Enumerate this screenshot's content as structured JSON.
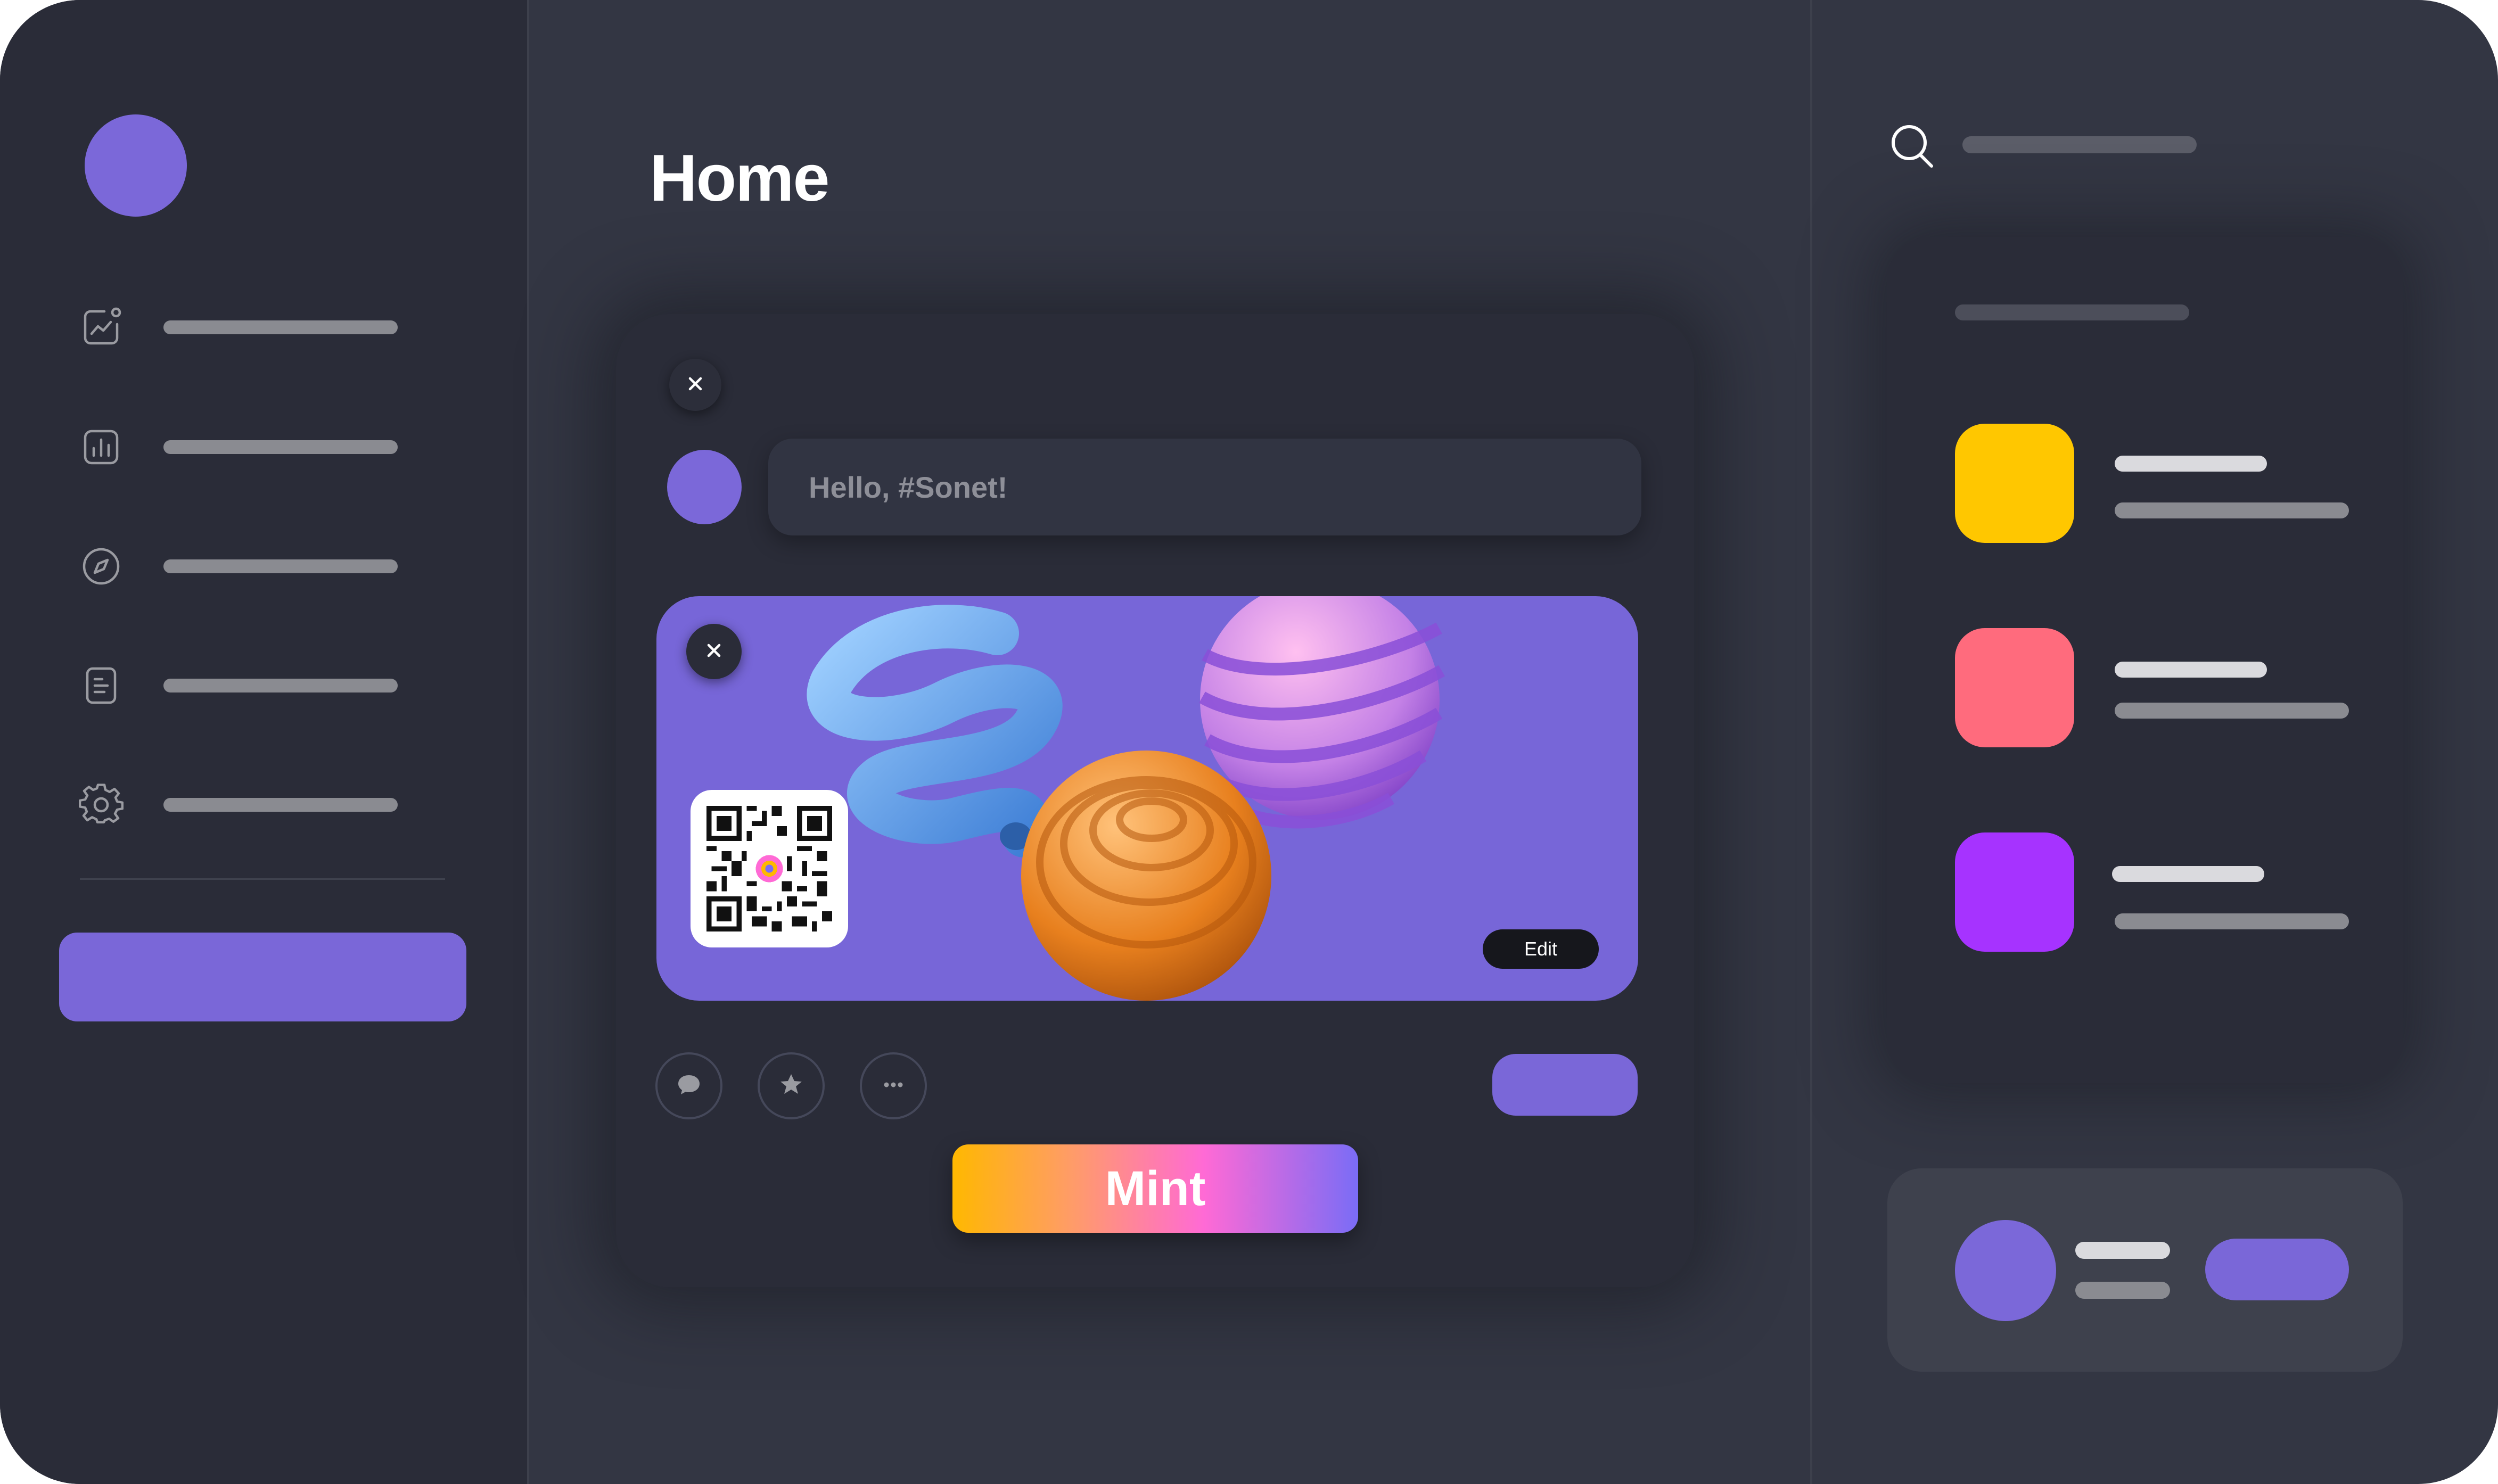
{
  "header": {
    "title": "Home"
  },
  "sidebar": {
    "items": [
      {
        "icon": "activity-chart-icon",
        "label": ""
      },
      {
        "icon": "bar-chart-icon",
        "label": ""
      },
      {
        "icon": "compass-icon",
        "label": ""
      },
      {
        "icon": "document-icon",
        "label": ""
      },
      {
        "icon": "settings-gear-icon",
        "label": ""
      }
    ],
    "primary_button_label": ""
  },
  "composer": {
    "input_value": "Hello, #Sonet!",
    "media": {
      "edit_label": "Edit"
    },
    "actions": [
      {
        "icon": "comment-icon"
      },
      {
        "icon": "star-icon"
      },
      {
        "icon": "more-dots-icon"
      }
    ],
    "secondary_button_label": "",
    "mint_label": "Mint"
  },
  "right_panel": {
    "search_placeholder": "",
    "list_items": [
      {
        "color": "#ffc700"
      },
      {
        "color": "#ff6b7d"
      },
      {
        "color": "#a633ff"
      }
    ],
    "profile_follow_label": ""
  },
  "colors": {
    "accent": "#7a67d8",
    "background": "#333643",
    "panel": "#2a2c38",
    "mint_gradient": [
      "#ffb800",
      "#ff6ad5",
      "#7a6cf6"
    ]
  }
}
